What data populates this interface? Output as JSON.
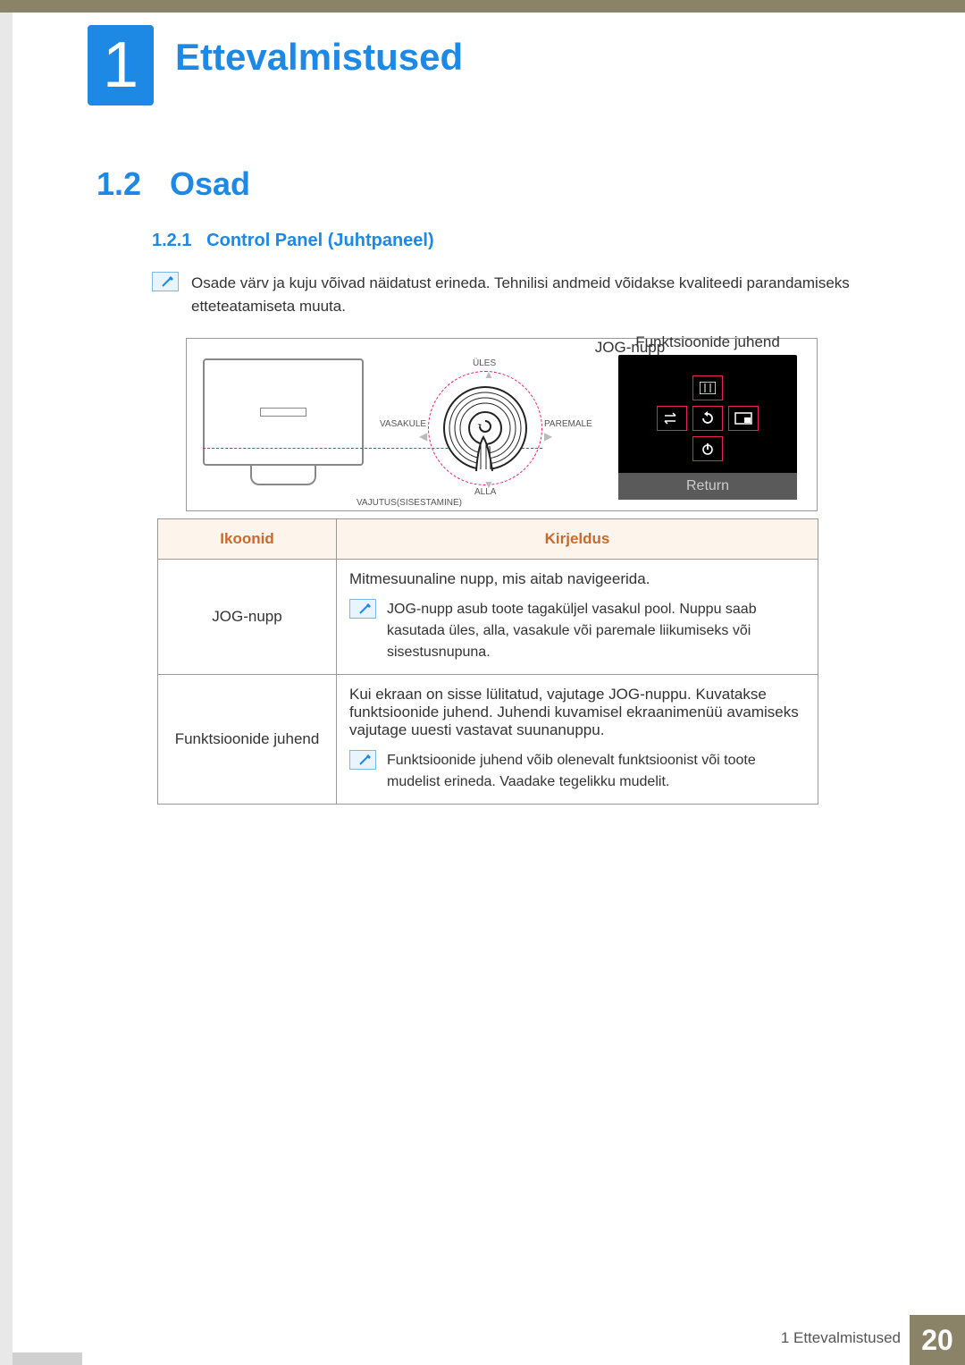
{
  "chapter": {
    "number": "1",
    "title": "Ettevalmistused"
  },
  "section": {
    "number": "1.2",
    "title": "Osad"
  },
  "subsection": {
    "number": "1.2.1",
    "title": "Control Panel (Juhtpaneel)"
  },
  "intro_note": "Osade värv ja kuju võivad näidatust erineda. Tehnilisi andmeid võidakse kvaliteedi parandamiseks etteteatamiseta muuta.",
  "diagram": {
    "jog_label": "JOG-nupp",
    "fk_label": "Funktsioonide juhend",
    "dir_up": "ÜLES",
    "dir_down": "ALLA",
    "dir_left": "VASAKULE",
    "dir_right": "PAREMALE",
    "press": "VAJUTUS(SISESTAMINE)",
    "return_label": "Return"
  },
  "table": {
    "headers": {
      "col1": "Ikoonid",
      "col2": "Kirjeldus"
    },
    "rows": [
      {
        "label": "JOG-nupp",
        "main": "Mitmesuunaline nupp, mis aitab navigeerida.",
        "note": "JOG-nupp asub toote tagaküljel vasakul pool. Nuppu saab kasutada üles, alla, vasakule või paremale liikumiseks või sisestusnupuna."
      },
      {
        "label": "Funktsioonide juhend",
        "main": "Kui ekraan on sisse lülitatud, vajutage JOG-nuppu. Kuvatakse funktsioonide juhend. Juhendi kuvamisel ekraanimenüü avamiseks vajutage uuesti vastavat suunanuppu.",
        "note": "Funktsioonide juhend võib olenevalt funktsioonist või toote mudelist erineda. Vaadake tegelikku mudelit."
      }
    ]
  },
  "footer": {
    "label": "1 Ettevalmistused",
    "page": "20"
  }
}
